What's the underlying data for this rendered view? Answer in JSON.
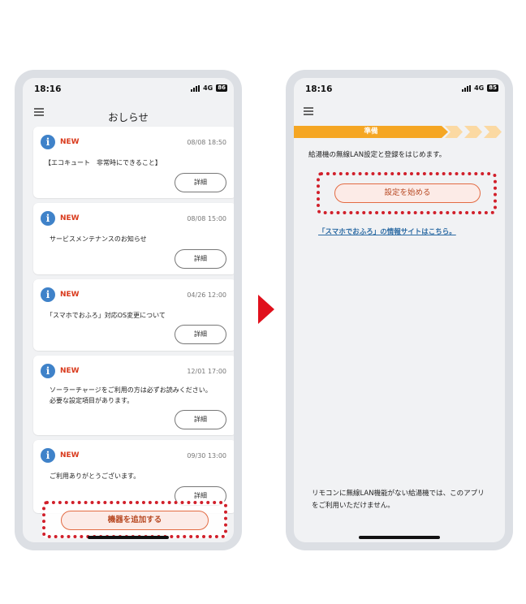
{
  "left_phone": {
    "status": {
      "time": "18:16",
      "network": "4G",
      "battery": "86"
    },
    "header": {
      "title": "おしらせ"
    },
    "notices": [
      {
        "label": "NEW",
        "date": "08/08 18:50",
        "lines": [
          "【エコキュート　非常時にできること】"
        ],
        "button": "詳細"
      },
      {
        "label": "NEW",
        "date": "08/08 15:00",
        "lines": [
          "サービスメンテナンスのお知らせ"
        ],
        "button": "詳細"
      },
      {
        "label": "NEW",
        "date": "04/26 12:00",
        "lines": [
          "「スマホでおふろ」対応OS変更について"
        ],
        "button": "詳細"
      },
      {
        "label": "NEW",
        "date": "12/01 17:00",
        "lines": [
          "ソーラーチャージをご利用の方は必ずお読みください。",
          "必要な設定項目があります。"
        ],
        "button": "詳細"
      },
      {
        "label": "NEW",
        "date": "09/30 13:00",
        "lines": [
          "ご利用ありがとうございます。"
        ],
        "button": "詳細"
      }
    ],
    "add_device_button": "機器を追加する",
    "icons": {
      "menu": "hamburger-menu-icon",
      "notice": "info-icon"
    }
  },
  "arrow": {
    "color": "#e0101c"
  },
  "right_phone": {
    "status": {
      "time": "18:16",
      "network": "4G",
      "battery": "85"
    },
    "progress": {
      "active_step": "準備",
      "steps_total": 4,
      "current": 1
    },
    "intro_text": "給湯機の無線LAN設定と登録をはじめます。",
    "start_button": "設定を始める",
    "info_link": "「スマホでおふろ」の情報サイトはこちら。",
    "footnote": "リモコンに無線LAN機能がない給湯機では、このアプリをご利用いただけません。"
  },
  "colors": {
    "accent": "#f5a623",
    "new_label": "#d93a1c",
    "info_icon": "#3f82c9",
    "highlight_border": "#d11f2a",
    "link": "#2b6aa3"
  }
}
